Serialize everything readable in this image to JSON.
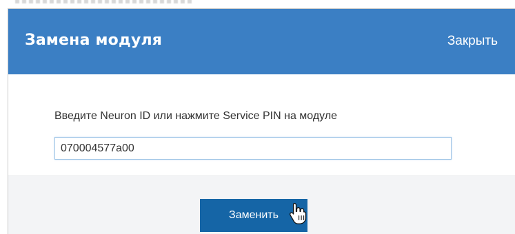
{
  "dialog": {
    "title": "Замена модуля",
    "close_label": "Закрыть",
    "prompt": "Введите Neuron ID или нажмите Service PIN на модуле",
    "neuron_id_value": "070004577a00",
    "replace_label": "Заменить"
  },
  "colors": {
    "header": "#3b7fc4",
    "button": "#1565a6",
    "footer": "#f3f4f6"
  },
  "icons": {
    "cursor": "hand-pointer-icon"
  }
}
